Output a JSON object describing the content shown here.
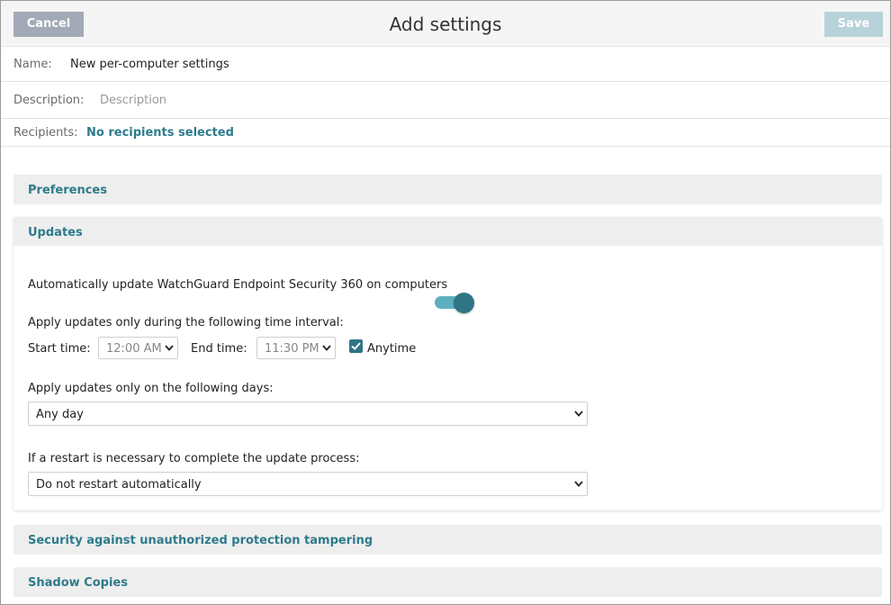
{
  "header": {
    "cancel_label": "Cancel",
    "title": "Add settings",
    "save_label": "Save"
  },
  "form": {
    "name_label": "Name:",
    "name_value": "New per-computer settings",
    "description_label": "Description:",
    "description_placeholder": "Description",
    "recipients_label": "Recipients:",
    "recipients_value": "No recipients selected"
  },
  "panels": {
    "preferences": "Preferences",
    "updates": "Updates",
    "security": "Security against unauthorized protection tampering",
    "shadow": "Shadow Copies"
  },
  "updates": {
    "auto_update_label": "Automatically update WatchGuard Endpoint Security 360 on computers",
    "auto_update_enabled": true,
    "interval_label": "Apply updates only during the following time interval:",
    "start_label": "Start time:",
    "start_value": "12:00 AM",
    "end_label": "End time:",
    "end_value": "11:30 PM",
    "anytime_label": "Anytime",
    "anytime_checked": true,
    "days_label": "Apply updates only on the following days:",
    "days_value": "Any day",
    "restart_label": "If a restart is necessary to complete the update process:",
    "restart_value": "Do not restart automatically"
  },
  "colors": {
    "accent": "#2e7b8c",
    "cancel_button": "#a1aab6",
    "save_button_disabled": "#b7d3d9",
    "toggle_track": "#5db0c0",
    "toggle_knob": "#2f7585"
  },
  "icons": [
    "chevron-down-icon",
    "check-icon"
  ]
}
